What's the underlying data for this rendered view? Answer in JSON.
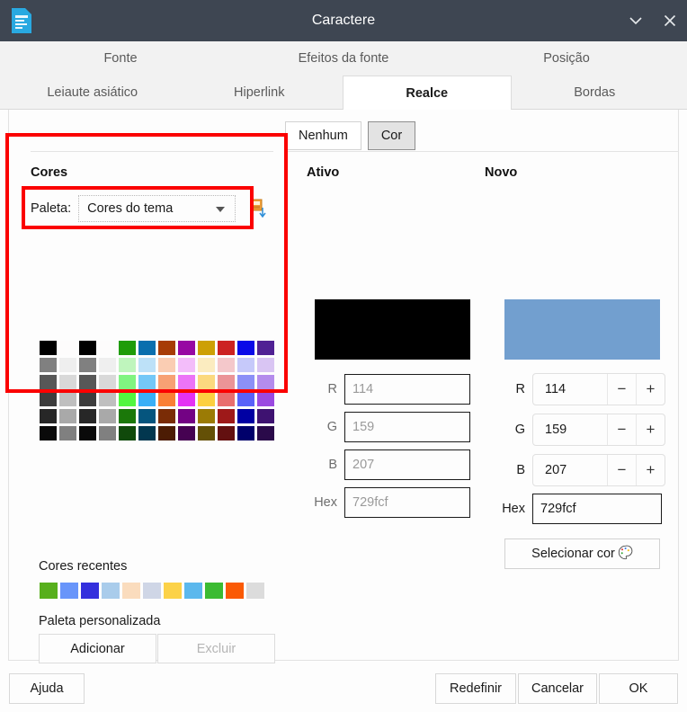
{
  "window": {
    "title": "Caractere",
    "app_icon": "document-icon",
    "collapse_icon": "chevron-down-icon",
    "close_icon": "close-icon"
  },
  "tabs": {
    "row1": [
      {
        "label": "Fonte",
        "active": false
      },
      {
        "label": "Efeitos da fonte",
        "active": false
      },
      {
        "label": "Posição",
        "active": false
      }
    ],
    "row2": [
      {
        "label": "Leiaute asiático",
        "active": false
      },
      {
        "label": "Hiperlink",
        "active": false
      },
      {
        "label": "Realce",
        "active": true
      },
      {
        "label": "Bordas",
        "active": false
      }
    ]
  },
  "segmented": {
    "none_label": "Nenhum",
    "color_label": "Cor",
    "selected": "Cor"
  },
  "colors_panel": {
    "title": "Cores",
    "palette_label": "Paleta:",
    "palette_value": "Cores do tema",
    "dropdown_icon": "chevron-down-icon",
    "pick_palette_icon": "load-palette-icon",
    "grid": [
      [
        "#000000",
        "#fdfcfc",
        "#000000",
        "#fdfcfc",
        "#1f9c09",
        "#0a6fae",
        "#a73c06",
        "#9708a3",
        "#cda005",
        "#cc2222",
        "#0a0ae8",
        "#502194"
      ],
      [
        "#808080",
        "#efefef",
        "#808080",
        "#efefef",
        "#bff5bd",
        "#bde1f8",
        "#facdb3",
        "#f3bdfa",
        "#fbecc0",
        "#f4c8cb",
        "#c6c9fa",
        "#d9c5f3"
      ],
      [
        "#575757",
        "#d9d9d9",
        "#575757",
        "#d9d9d9",
        "#80f481",
        "#74c8f7",
        "#f7a174",
        "#ec74f7",
        "#fbd97f",
        "#eb9497",
        "#8c90f7",
        "#b48cec"
      ],
      [
        "#3d3d3d",
        "#bfbfbf",
        "#3d3d3d",
        "#bfbfbf",
        "#52f640",
        "#39aff6",
        "#fa7f34",
        "#e432f4",
        "#fcd040",
        "#e96e6e",
        "#5a62f9",
        "#9b4ae1"
      ],
      [
        "#272727",
        "#a9a9a9",
        "#272727",
        "#a9a9a9",
        "#1b7809",
        "#05557e",
        "#7a2c06",
        "#730284",
        "#9b7b05",
        "#9e1919",
        "#0000a3",
        "#3e1271"
      ],
      [
        "#0a0a0a",
        "#808080",
        "#0a0a0a",
        "#808080",
        "#10490b",
        "#02374f",
        "#4c1c04",
        "#460252",
        "#645006",
        "#631010",
        "#00006b",
        "#2a0a4a"
      ]
    ],
    "recent_label": "Cores recentes",
    "recent_colors": [
      "#57af1c",
      "#6895fa",
      "#3430dd",
      "#a9cceb",
      "#fadcbd",
      "#cfd6e6",
      "#fcd248",
      "#5bb8ed",
      "#3bbb32",
      "#fa5a05",
      "#dcdcdc"
    ],
    "custom_label": "Paleta personalizada",
    "custom_add": "Adicionar",
    "custom_delete": "Excluir"
  },
  "active": {
    "title": "Ativo",
    "preview_color": "#000000",
    "fields": [
      {
        "label": "R",
        "value": "114"
      },
      {
        "label": "G",
        "value": "159"
      },
      {
        "label": "B",
        "value": "207"
      }
    ],
    "hex_label": "Hex",
    "hex_value": "729fcf"
  },
  "new": {
    "title": "Novo",
    "preview_color": "#729fcf",
    "fields": [
      {
        "label": "R",
        "value": "114",
        "minus": "−",
        "plus": "+"
      },
      {
        "label": "G",
        "value": "159",
        "minus": "−",
        "plus": "+"
      },
      {
        "label": "B",
        "value": "207",
        "minus": "−",
        "plus": "+"
      }
    ],
    "hex_label": "Hex",
    "hex_value": "729fcf",
    "pick_color_label": "Selecionar cor",
    "pick_color_icon": "color-palette-icon"
  },
  "footer": {
    "help": "Ajuda",
    "reset": "Redefinir",
    "cancel": "Cancelar",
    "ok": "OK"
  },
  "annotations": {
    "color": "#fb0000",
    "boxes": [
      "colors-panel-highlight",
      "palette-dropdown-highlight"
    ]
  }
}
